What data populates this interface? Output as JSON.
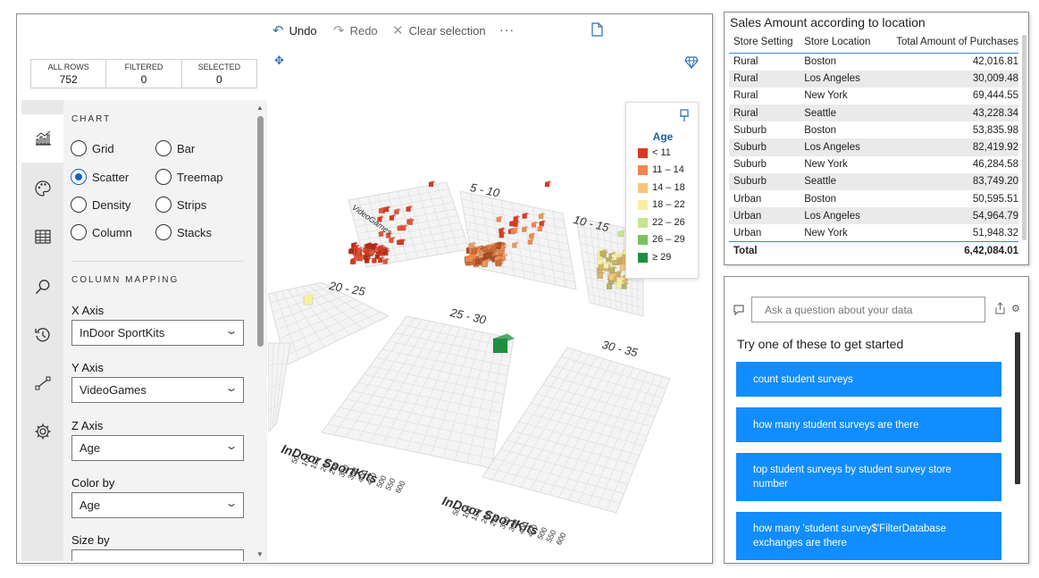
{
  "toolbar": {
    "undo": "Undo",
    "redo": "Redo",
    "clear": "Clear selection",
    "more": "···"
  },
  "counts": [
    {
      "label": "ALL ROWS",
      "value": "752"
    },
    {
      "label": "FILTERED",
      "value": "0"
    },
    {
      "label": "SELECTED",
      "value": "0"
    }
  ],
  "panel": {
    "chart_title": "CHART",
    "chart_types": [
      "Grid",
      "Bar",
      "Scatter",
      "Treemap",
      "Density",
      "Strips",
      "Column",
      "Stacks"
    ],
    "selected_chart": "Scatter",
    "mapping_title": "COLUMN MAPPING",
    "fields": [
      {
        "label": "X Axis",
        "value": "InDoor SportKits"
      },
      {
        "label": "Y Axis",
        "value": "VideoGames"
      },
      {
        "label": "Z Axis",
        "value": "Age"
      },
      {
        "label": "Color by",
        "value": "Age"
      },
      {
        "label": "Size by",
        "value": ""
      }
    ]
  },
  "plot": {
    "facets": [
      "5 - 10",
      "10 - 15",
      "20 - 25",
      "25 - 30",
      "30 - 35"
    ],
    "x_axis_title": "InDoor SportKits",
    "y_axis_title": "VideoGames",
    "x_ticks": [
      "50",
      "100",
      "150",
      "200",
      "250",
      "300",
      "350",
      "400",
      "450",
      "500",
      "550",
      "600"
    ]
  },
  "legend": {
    "title": "Age",
    "items": [
      {
        "label": "< 11",
        "color": "#d73b22"
      },
      {
        "label": "11 – 14",
        "color": "#f0874c"
      },
      {
        "label": "14 – 18",
        "color": "#f6c57d"
      },
      {
        "label": "18 – 22",
        "color": "#f6f0a6"
      },
      {
        "label": "22 – 26",
        "color": "#c5e590"
      },
      {
        "label": "26 – 29",
        "color": "#78c261"
      },
      {
        "label": "≥ 29",
        "color": "#1f8f3f"
      }
    ]
  },
  "sales_table": {
    "title": "Sales Amount according to location",
    "headers": [
      "Store Setting",
      "Store Location",
      "Total Amount of Purchases"
    ],
    "rows": [
      [
        "Rural",
        "Boston",
        "42,016.81"
      ],
      [
        "Rural",
        "Los Angeles",
        "30,009.48"
      ],
      [
        "Rural",
        "New York",
        "69,444.55"
      ],
      [
        "Rural",
        "Seattle",
        "43,228.34"
      ],
      [
        "Suburb",
        "Boston",
        "53,835.98"
      ],
      [
        "Suburb",
        "Los Angeles",
        "82,419.92"
      ],
      [
        "Suburb",
        "New York",
        "46,284.58"
      ],
      [
        "Suburb",
        "Seattle",
        "83,749.20"
      ],
      [
        "Urban",
        "Boston",
        "50,595.51"
      ],
      [
        "Urban",
        "Los Angeles",
        "54,964.79"
      ],
      [
        "Urban",
        "New York",
        "51,948.32"
      ]
    ],
    "total_label": "Total",
    "total_value": "6,42,084.01"
  },
  "qa": {
    "placeholder": "Ask a question about your data",
    "prompt": "Try one of these to get started",
    "suggestions": [
      "count student surveys",
      "how many student surveys are there",
      "top student surveys by student survey store number",
      "how many 'student survey$'FilterDatabase exchanges are there"
    ]
  }
}
